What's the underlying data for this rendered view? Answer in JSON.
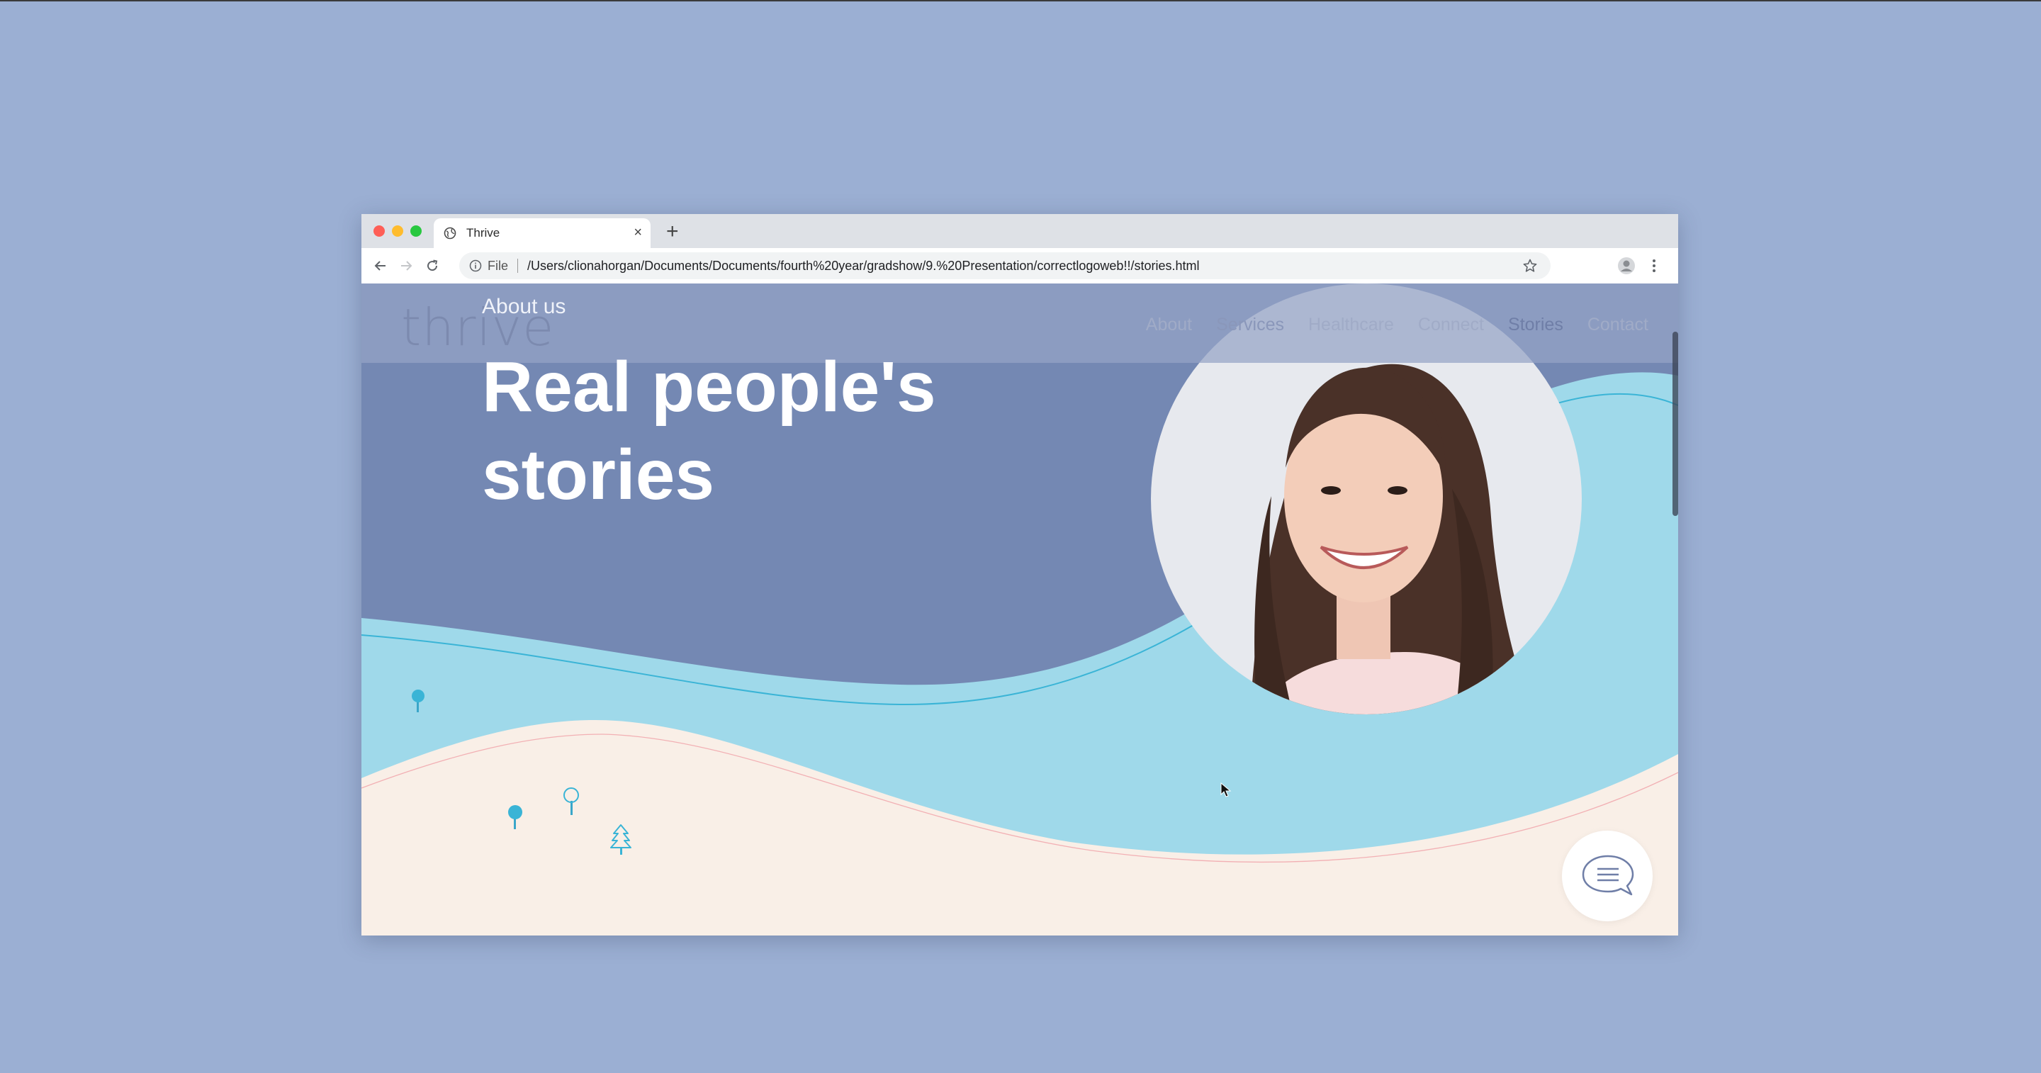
{
  "browser": {
    "tab_title": "Thrive",
    "tab_close": "×",
    "new_tab": "+",
    "scheme_chip": "File",
    "url": "/Users/clionahorgan/Documents/Documents/fourth%20year/gradshow/9.%20Presentation/correctlogoweb!!/stories.html"
  },
  "site": {
    "logo_text": "thrive",
    "nav": [
      "About",
      "Services",
      "Healthcare",
      "Connect",
      "Stories",
      "Contact"
    ],
    "active_nav": "Stories"
  },
  "hero": {
    "eyebrow": "About us",
    "title_line1": "Real people's",
    "title_line2": "stories"
  },
  "icons": {
    "tab": "globe-icon",
    "back": "back-arrow-icon",
    "forward": "forward-arrow-icon",
    "reload": "reload-icon",
    "info": "info-icon",
    "bookmark": "star-icon",
    "profile": "profile-icon",
    "menu": "kebab-menu-icon",
    "chat": "chat-bubble-icon"
  },
  "colors": {
    "page_bg": "#9bafd3",
    "hero_bg": "#7488b3",
    "wave_blue": "#9fd9ea",
    "wave_cream": "#f9efe7",
    "accent": "#3ab4d6"
  }
}
